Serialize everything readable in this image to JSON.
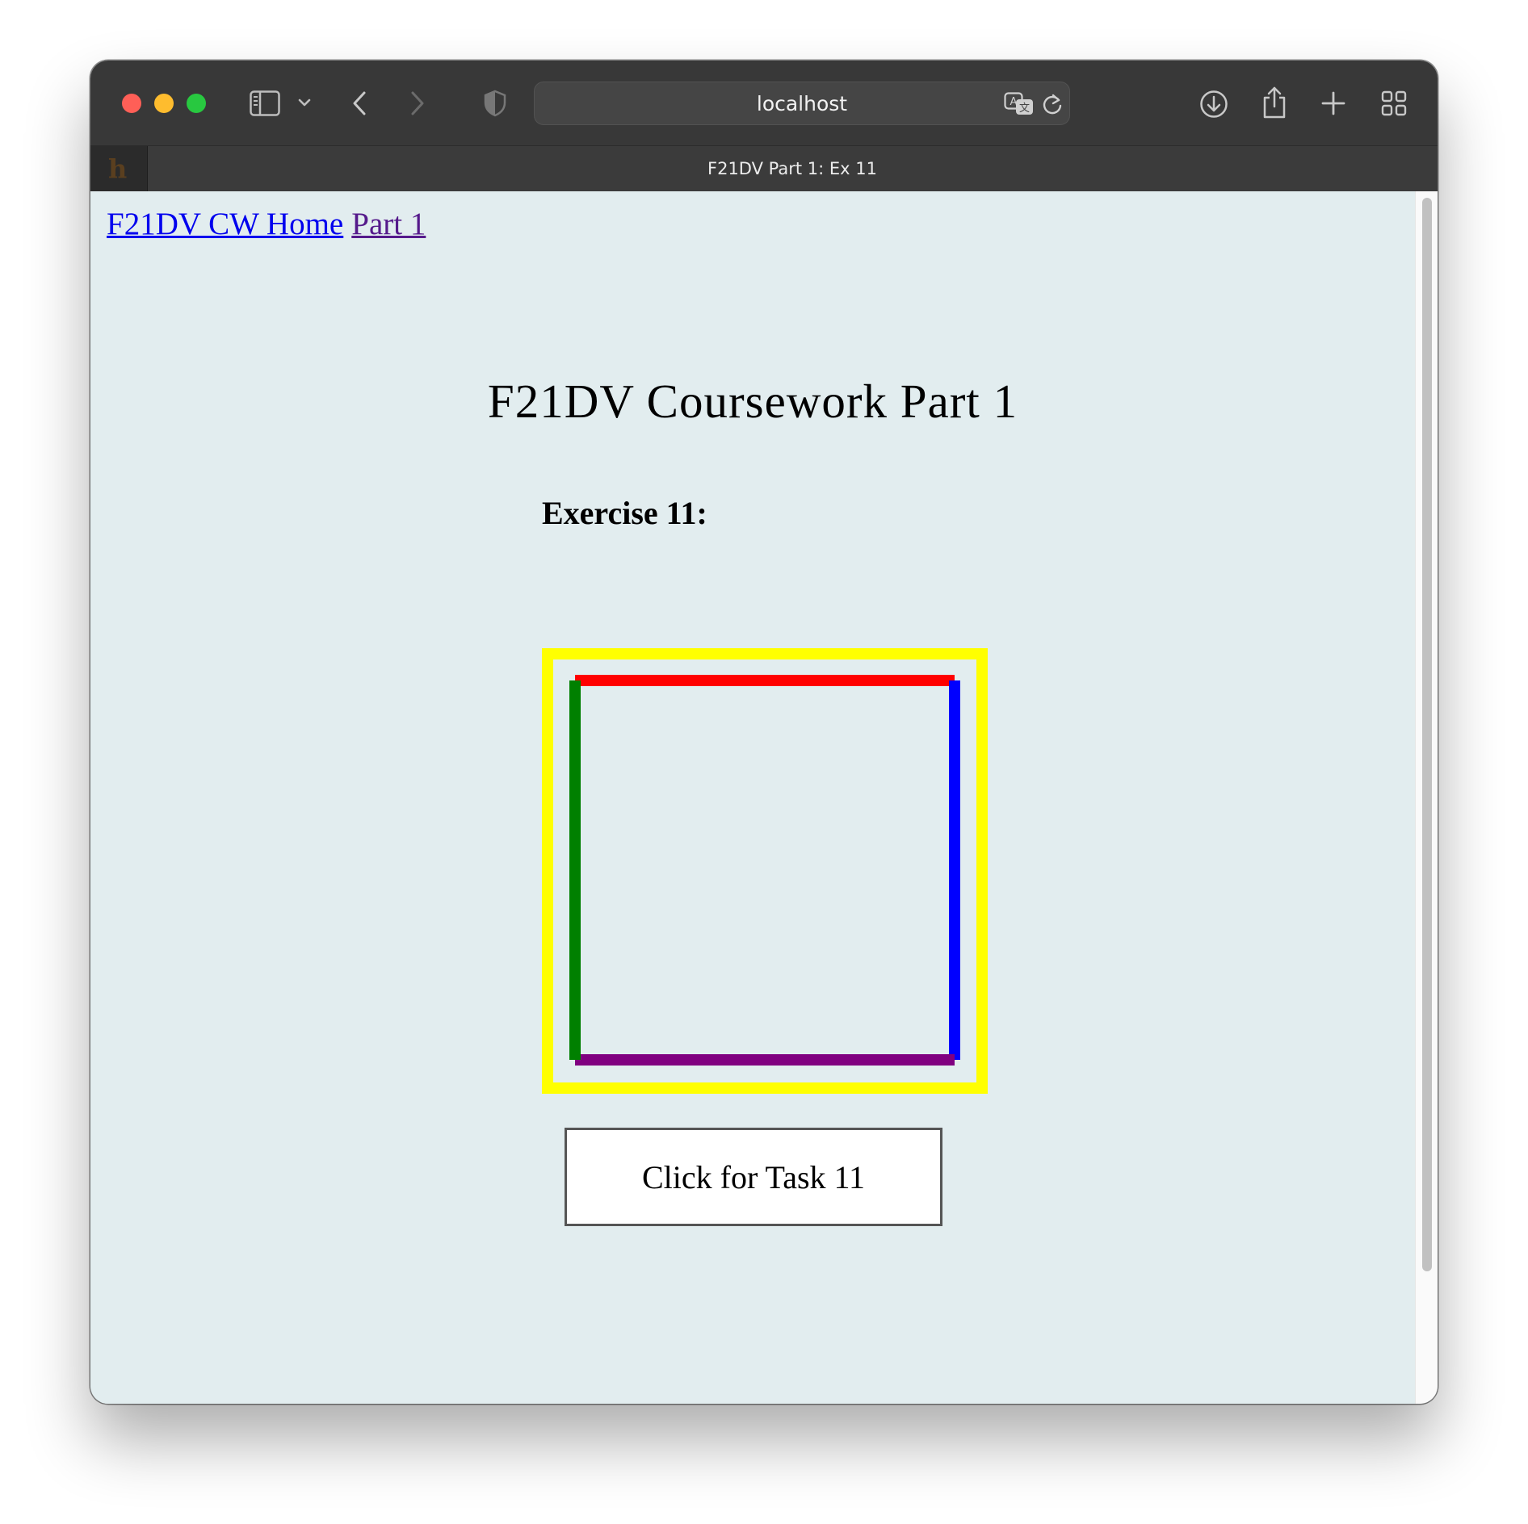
{
  "browser": {
    "address_bar": {
      "url_text": "localhost"
    },
    "tab": {
      "title": "F21DV Part 1: Ex 11",
      "favicon_letter": "h"
    },
    "toolbar_icons": [
      "sidebar-icon",
      "chevron-down-icon",
      "back-icon",
      "forward-icon",
      "shield-icon",
      "translate-icon",
      "reload-icon",
      "download-icon",
      "share-icon",
      "new-tab-icon",
      "tab-overview-icon"
    ]
  },
  "page": {
    "nav": {
      "home_link": "F21DV CW Home",
      "part_link": "Part 1"
    },
    "title": "F21DV Coursework Part 1",
    "exercise_heading": "Exercise 11:",
    "shape": {
      "outer_square_color": "#ffff00",
      "top_line_color": "#ff0000",
      "right_line_color": "#0000ff",
      "bottom_line_color": "#800080",
      "left_line_color": "#008000"
    },
    "task_button_label": "Click for Task 11"
  }
}
